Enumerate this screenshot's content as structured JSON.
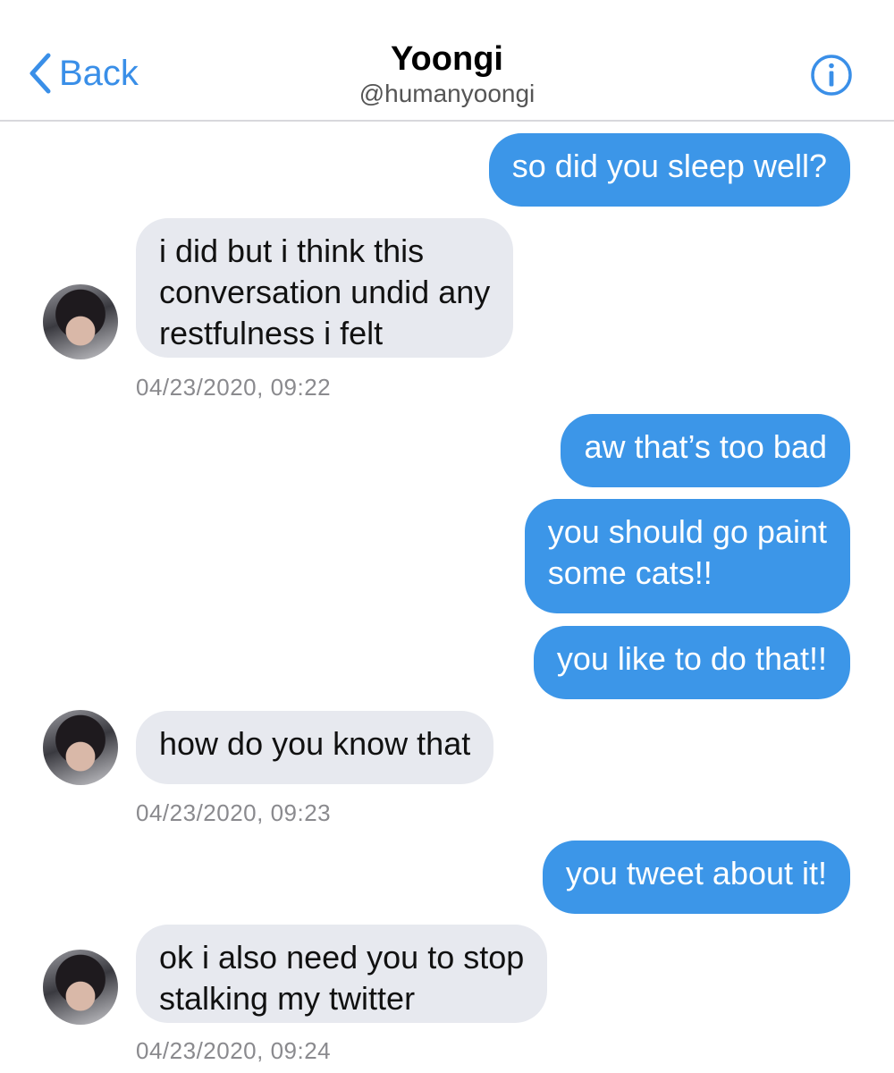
{
  "header": {
    "back_label": "Back",
    "title": "Yoongi",
    "handle": "@humanyoongi",
    "back_icon": "chevron-left-icon",
    "info_icon": "info-circle-icon",
    "accent_color": "#3a8fe8"
  },
  "colors": {
    "outgoing_bubble": "#3c96e8",
    "incoming_bubble": "#e7e9ef",
    "timestamp": "#8a8a8e"
  },
  "messages": [
    {
      "direction": "outgoing",
      "lines": [
        "so did you sleep well?"
      ]
    },
    {
      "direction": "incoming",
      "lines": [
        "i did but i think this",
        "conversation undid any",
        "restfulness i felt"
      ],
      "timestamp": "04/23/2020, 09:22"
    },
    {
      "direction": "outgoing",
      "lines": [
        "aw that’s too bad"
      ]
    },
    {
      "direction": "outgoing",
      "lines": [
        "you should go paint",
        "some cats!!"
      ]
    },
    {
      "direction": "outgoing",
      "lines": [
        "you like to do that!!"
      ]
    },
    {
      "direction": "incoming",
      "lines": [
        "how do you know that"
      ],
      "timestamp": "04/23/2020, 09:23"
    },
    {
      "direction": "outgoing",
      "lines": [
        "you tweet about it!"
      ]
    },
    {
      "direction": "incoming",
      "lines": [
        "ok i also need you to stop",
        "stalking my twitter"
      ],
      "timestamp": "04/23/2020, 09:24"
    }
  ]
}
